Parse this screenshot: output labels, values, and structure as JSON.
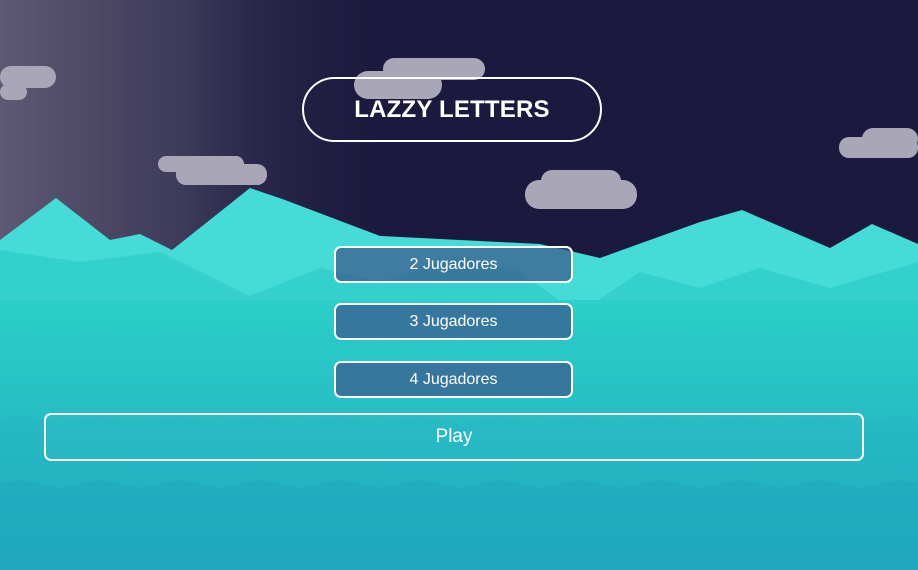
{
  "game": {
    "title": "LAZZY LETTERS",
    "player_options": [
      {
        "label": "2 Jugadores"
      },
      {
        "label": "3 Jugadores"
      },
      {
        "label": "4 Jugadores"
      }
    ],
    "play_label": "Play"
  },
  "colors": {
    "sky": "#1b1a3e",
    "mountains": "#45dcd8",
    "water": "#22aec0",
    "clouds": "#a9a7b7",
    "button_fill": "#3c548a"
  }
}
